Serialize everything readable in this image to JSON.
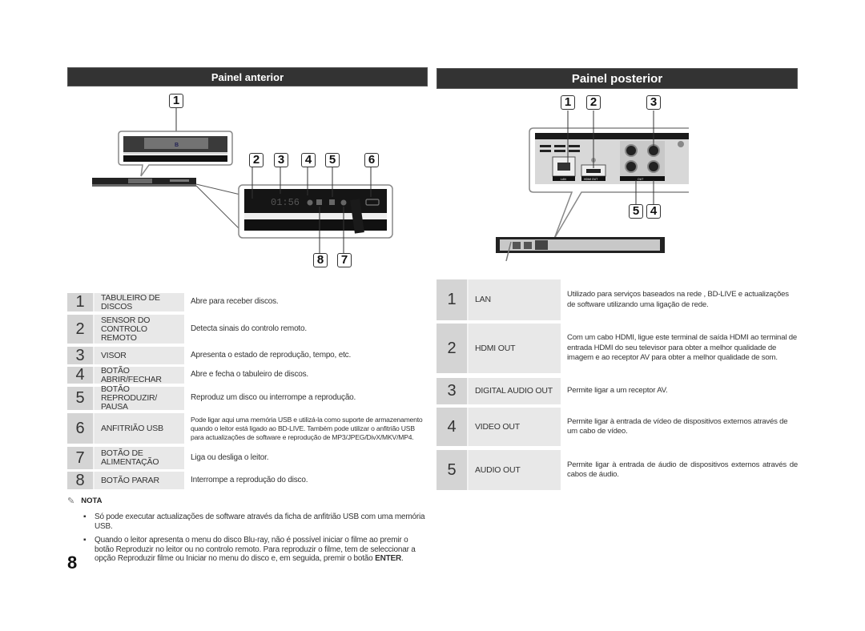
{
  "front_panel": {
    "title": "Painel anterior",
    "callouts": [
      "1",
      "2",
      "3",
      "4",
      "5",
      "6",
      "8",
      "7"
    ],
    "display_time": "01:56",
    "items": [
      {
        "num": "1",
        "label": "TABULEIRO DE DISCOS",
        "desc": "Abre para receber discos."
      },
      {
        "num": "2",
        "label": "SENSOR DO CONTROLO REMOTO",
        "desc": "Detecta sinais do controlo remoto."
      },
      {
        "num": "3",
        "label": "VISOR",
        "desc": "Apresenta o estado de reprodução, tempo, etc."
      },
      {
        "num": "4",
        "label": "BOTÃO ABRIR/FECHAR",
        "desc": "Abre e fecha o tabuleiro de discos."
      },
      {
        "num": "5",
        "label": "BOTÃO REPRODUZIR/ PAUSA",
        "desc": "Reproduz um disco ou interrompe a reprodução."
      },
      {
        "num": "6",
        "label": "ANFITRIÃO USB",
        "desc": "Pode ligar aqui uma memória USB e utilizá-la como suporte de armazenamento quando o leitor está ligado ao BD-LIVE. Também pode utilizar o anfitrião USB para actualizações de software e reprodução de MP3/JPEG/DivX/MKV/MP4."
      },
      {
        "num": "7",
        "label": "BOTÃO DE ALIMENTAÇÃO",
        "desc": "Liga ou desliga o leitor."
      },
      {
        "num": "8",
        "label": "BOTÃO PARAR",
        "desc": "Interrompe a reprodução do disco."
      }
    ]
  },
  "rear_panel": {
    "title": "Painel posterior",
    "callouts": [
      "1",
      "2",
      "3",
      "5",
      "4"
    ],
    "port_labels": {
      "lan": "LAN",
      "hdmi": "HDMI OUT",
      "out": "OUT"
    },
    "items": [
      {
        "num": "1",
        "label": "LAN",
        "desc": "Utilizado para serviços baseados na rede , BD-LIVE e actualizações de software utilizando uma ligação de rede."
      },
      {
        "num": "2",
        "label": "HDMI OUT",
        "desc": "Com um cabo HDMI, ligue este terminal de saída HDMI ao terminal de entrada HDMI do seu televisor para obter a melhor qualidade de imagem e ao receptor AV para obter a melhor qualidade de som."
      },
      {
        "num": "3",
        "label": "DIGITAL AUDIO OUT",
        "desc": "Permite ligar a um receptor AV."
      },
      {
        "num": "4",
        "label": "VIDEO OUT",
        "desc": "Permite ligar à entrada de vídeo de dispositivos externos através de um cabo de vídeo."
      },
      {
        "num": "5",
        "label": "AUDIO OUT",
        "desc": "Permite ligar à entrada de áudio de dispositivos externos através de cabos de áudio."
      }
    ]
  },
  "note": {
    "title": "NOTA",
    "bullets": [
      "Só pode executar actualizações de software através da ficha de anfitrião USB com uma memória USB.",
      "Quando o leitor apresenta o menu do disco Blu-ray, não é possível iniciar o filme ao premir o botão Reproduzir no leitor ou no controlo remoto. Para reproduzir o filme, tem de seleccionar a opção Reproduzir filme ou Iniciar no menu do disco e, em seguida, premir o botão"
    ],
    "bold_tail": "ENTER",
    "tail_end": "."
  },
  "page_number": "8"
}
